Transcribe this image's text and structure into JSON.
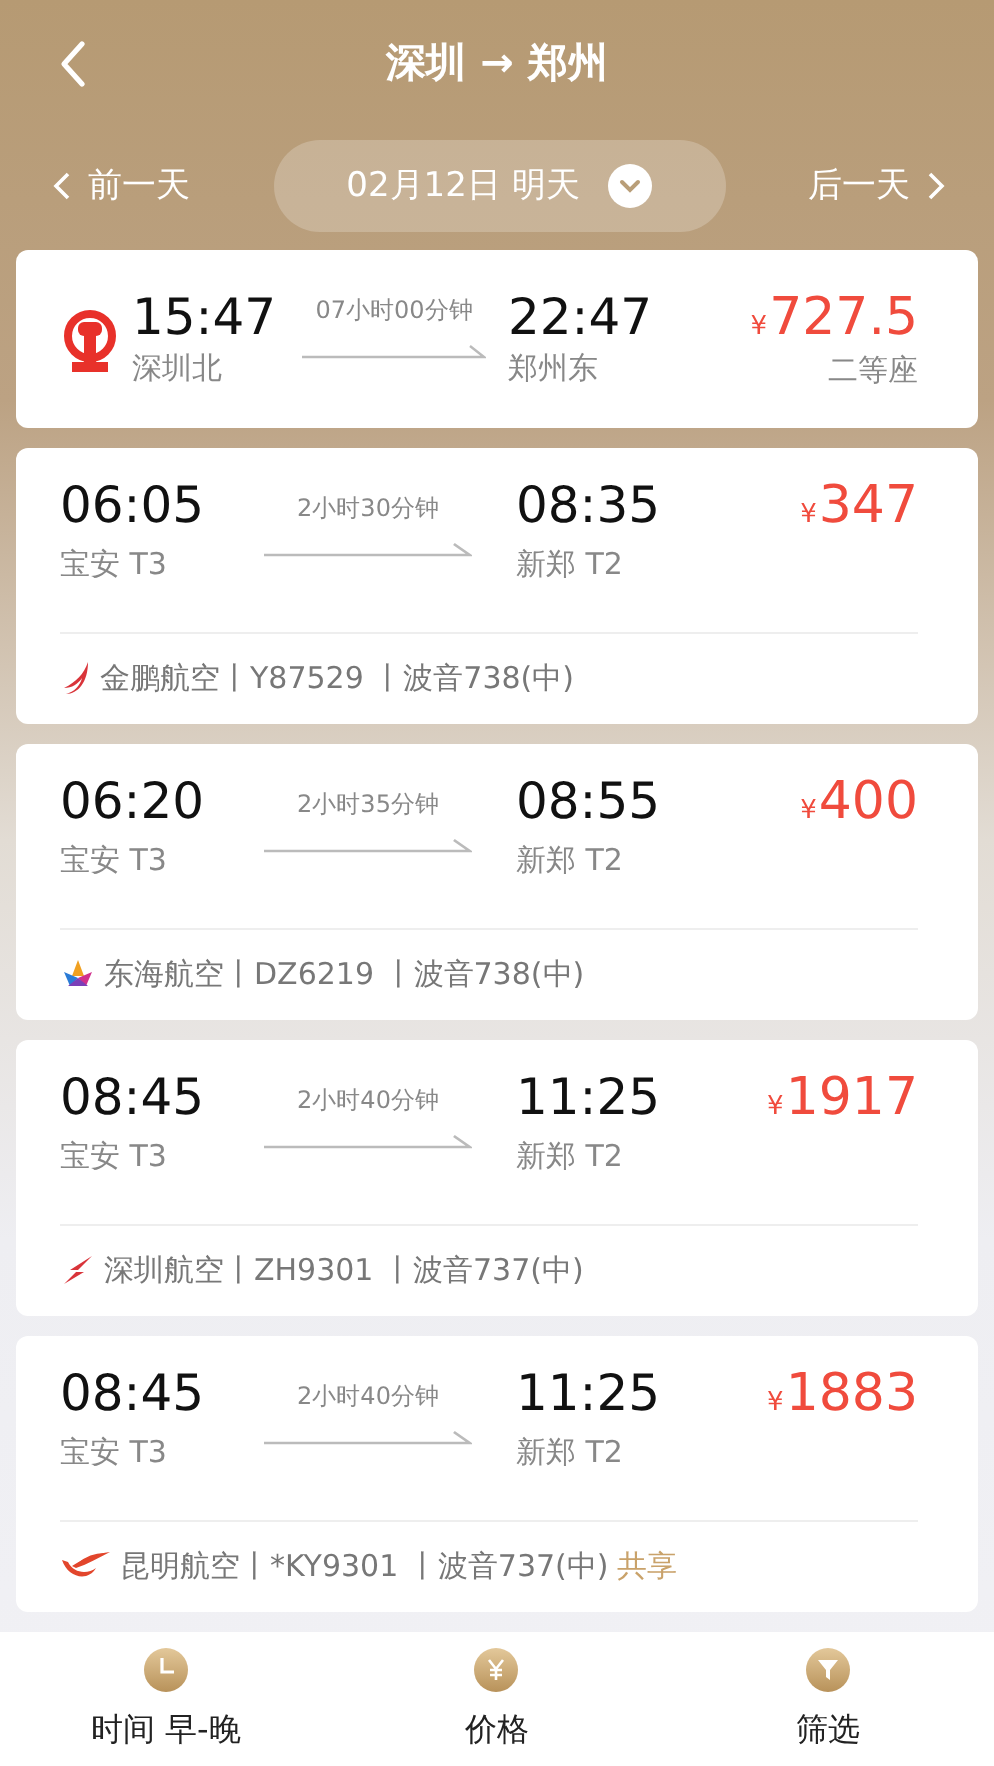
{
  "header": {
    "title": "深圳 → 郑州"
  },
  "date_bar": {
    "prev": "前一天",
    "date": "02月12日 明天",
    "next": "后一天"
  },
  "train": {
    "depart_time": "15:47",
    "depart_station": "深圳北",
    "duration": "07小时00分钟",
    "arrive_time": "22:47",
    "arrive_station": "郑州东",
    "currency": "¥",
    "price": "727.5",
    "seat": "二等座"
  },
  "flights": [
    {
      "depart_time": "06:05",
      "depart_airport": "宝安 T3",
      "duration": "2小时30分钟",
      "arrive_time": "08:35",
      "arrive_airport": "新郑 T2",
      "currency": "¥",
      "price": "347",
      "airline": {
        "kind": "wing",
        "info": "金鹏航空丨Y87529 丨波音738(中)"
      }
    },
    {
      "depart_time": "06:20",
      "depart_airport": "宝安 T3",
      "duration": "2小时35分钟",
      "arrive_time": "08:55",
      "arrive_airport": "新郑 T2",
      "currency": "¥",
      "price": "400",
      "airline": {
        "kind": "flower",
        "info": "东海航空丨DZ6219 丨波音738(中)"
      }
    },
    {
      "depart_time": "08:45",
      "depart_airport": "宝安 T3",
      "duration": "2小时40分钟",
      "arrive_time": "11:25",
      "arrive_airport": "新郑 T2",
      "currency": "¥",
      "price": "1917",
      "airline": {
        "kind": "crane",
        "info": "深圳航空丨ZH9301 丨波音737(中)"
      }
    },
    {
      "depart_time": "08:45",
      "depart_airport": "宝安 T3",
      "duration": "2小时40分钟",
      "arrive_time": "11:25",
      "arrive_airport": "新郑 T2",
      "currency": "¥",
      "price": "1883",
      "airline": {
        "kind": "phoenix",
        "info": "昆明航空丨*KY9301 丨波音737(中)",
        "shared": "共享"
      }
    }
  ],
  "bottom_bar": [
    {
      "kind": "clock",
      "label": "时间 早-晚"
    },
    {
      "kind": "yen",
      "label": "价格"
    },
    {
      "kind": "filter",
      "label": "筛选"
    }
  ]
}
